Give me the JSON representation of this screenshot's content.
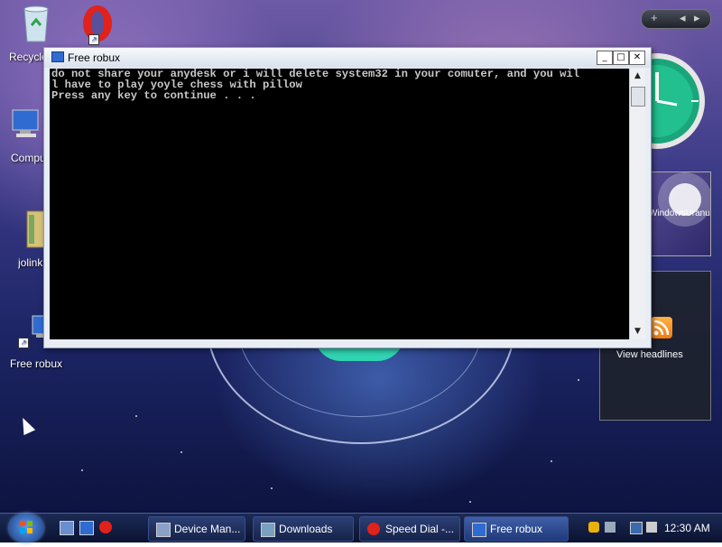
{
  "desktop": {
    "icons": [
      {
        "id": "recycle",
        "label": "Recycle Bin"
      },
      {
        "id": "opera",
        "label": "Opera"
      },
      {
        "id": "computer",
        "label": "Computer"
      },
      {
        "id": "jolink",
        "label": "jolink"
      },
      {
        "id": "freerobux",
        "label": "Free robux"
      }
    ]
  },
  "sidebar": {
    "add": "+",
    "prev": "◂",
    "next": "▸",
    "slideshow_caption": "WindowsUranus",
    "feed_label": "View headlines"
  },
  "console_window": {
    "title": "Free robux",
    "minimize": "_",
    "maximize": "□",
    "close": "✕",
    "lines": [
      "do not share your anydesk or i will delete system32 in your comuter, and you wil",
      "l have to play yoyle chess with pillow",
      "Press any key to continue . . ."
    ],
    "scroll_up": "▲",
    "scroll_down": "▼"
  },
  "taskbar": {
    "buttons": [
      {
        "label": "Device Man...",
        "icon": "device-manager-icon"
      },
      {
        "label": "Downloads",
        "icon": "folder-icon"
      },
      {
        "label": "Speed Dial -...",
        "icon": "opera-icon"
      },
      {
        "label": "Free robux",
        "icon": "console-icon",
        "active": true
      }
    ],
    "clock": "12:30 AM"
  },
  "colors": {
    "accent": "#2f6bd0",
    "opera": "#e0221b",
    "teal": "#2fd4b0"
  }
}
